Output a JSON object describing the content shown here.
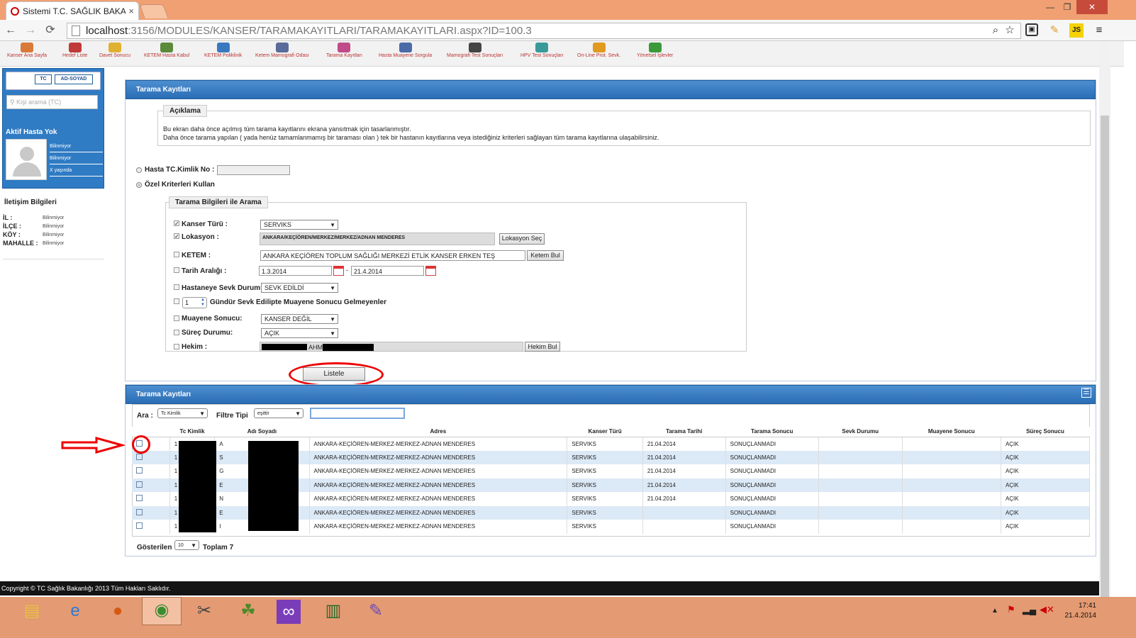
{
  "browser": {
    "tab_title": "Sistemi T.C. SAĞLIK BAKA",
    "tab_close": "×",
    "url_host": "localhost",
    "url_rest": ":3156/MODULES/KANSER/TARAMAKAYITLARI/TARAMAKAYITLARI.aspx?ID=100.3",
    "win_buttons": [
      "—",
      "❐",
      "✕"
    ],
    "nav": [
      "←",
      "→",
      "⟳"
    ]
  },
  "menu": [
    "Kanser Ana Sayfa",
    "Hedef Liste",
    "Davet Sonucu",
    "KETEM Hasta Kabul",
    "KETEM Poliklinik",
    "Ketem Mamografi Odası",
    "Tarama Kayıtları",
    "Hasta Muayene Sorgula",
    "Mamografi Test Sonuçları",
    "HPV Test Sonuçları",
    "On-Line Prot. Sevk.",
    "Yönetsel İşlevler"
  ],
  "sidebar": {
    "tab_tc": "TC",
    "tab_ad": "AD-SOYAD",
    "search_placeholder": "Kişi arama (TC)",
    "aktif": "Aktif Hasta Yok",
    "info": [
      "Bilinmiyor",
      "Bilinmiyor",
      "X yaşında"
    ],
    "iletisim": "İletişim Bilgileri",
    "rows": [
      {
        "k": "İL :",
        "v": "Bilinmiyor"
      },
      {
        "k": "İLÇE :",
        "v": "Bilinmiyor"
      },
      {
        "k": "KÖY :",
        "v": "Bilinmiyor"
      },
      {
        "k": "MAHALLE :",
        "v": "Bilinmiyor"
      }
    ]
  },
  "panel1": {
    "title": "Tarama Kayıtları",
    "aciklama_legend": "Açıklama",
    "desc1": "Bu ekran daha önce açılmış tüm tarama kayıtlarını ekrana yansıtmak için tasarlanmıştır.",
    "desc2": "Daha önce tarama yapılan ( yada henüz tamamlanmamış bir taraması olan ) tek bir hastanın kayıtlarına veya istediğiniz kriterleri sağlayan tüm tarama kayıtlarına ulaşabilirsiniz.",
    "radio_tc": "Hasta TC.Kimlik No :",
    "radio_ozel": "Özel Kriterleri Kullan",
    "search_legend": "Tarama Bilgileri ile Arama",
    "kanser_turu": "Kanser Türü :",
    "kanser_val": "SERVIKS",
    "lokasyon": "Lokasyon :",
    "lokasyon_val": "ANKARA/KEÇİÖREN/MERKEZ/MERKEZ/ADNAN MENDERES",
    "lokasyon_btn": "Lokasyon Seç",
    "ketem": "KETEM :",
    "ketem_val": "ANKARA KEÇİÖREN TOPLUM SAĞLIĞI MERKEZİ ETLİK KANSER ERKEN TEŞ",
    "ketem_btn": "Ketem Bul",
    "tarih": "Tarih Aralığı :",
    "tarih1": "1.3.2014",
    "tarih_sep": "-",
    "tarih2": "21.4.2014",
    "sevk": "Hastaneye Sevk Durum",
    "sevk_val": "SEVK EDİLDİ",
    "gun_val": "1",
    "gun_lbl": "Gündür Sevk Edilipte Muayene Sonucu Gelmeyenler",
    "muayene": "Muayene Sonucu:",
    "muayene_val": "KANSER DEĞİL",
    "surec": "Süreç Durumu:",
    "surec_val": "AÇIK",
    "hekim": "Hekim :",
    "hekim_val": "AHM",
    "hekim_btn": "Hekim Bul",
    "listele": "Listele"
  },
  "panel2": {
    "title": "Tarama Kayıtları",
    "ara": "Ara :",
    "ara_val": "Tc Kimlik",
    "filtre": "Filtre Tipi",
    "filtre_val": "eşittir",
    "columns": [
      "",
      "Tc Kimlik",
      "Adı Soyadı",
      "Adres",
      "Kanser Türü",
      "Tarama Tarihi",
      "Tarama Sonucu",
      "Sevk Durumu",
      "Muayene Sonucu",
      "Süreç Sonucu"
    ],
    "rows": [
      {
        "tc": "1",
        "ad": "A",
        "adres": "ANKARA-KEÇİÖREN-MERKEZ-MERKEZ-ADNAN MENDERES",
        "tur": "SERVIKS",
        "tarih": "21.04.2014",
        "sonuc": "SONUÇLANMADI",
        "sevk": "",
        "muayene": "",
        "surec": "AÇIK"
      },
      {
        "tc": "1",
        "ad": "S",
        "adres": "ANKARA-KEÇİÖREN-MERKEZ-MERKEZ-ADNAN MENDERES",
        "tur": "SERVIKS",
        "tarih": "21.04.2014",
        "sonuc": "SONUÇLANMADI",
        "sevk": "",
        "muayene": "",
        "surec": "AÇIK"
      },
      {
        "tc": "1",
        "ad": "G",
        "adres": "ANKARA-KEÇİÖREN-MERKEZ-MERKEZ-ADNAN MENDERES",
        "tur": "SERVIKS",
        "tarih": "21.04.2014",
        "sonuc": "SONUÇLANMADI",
        "sevk": "",
        "muayene": "",
        "surec": "AÇIK"
      },
      {
        "tc": "1",
        "ad": "E",
        "adres": "ANKARA-KEÇİÖREN-MERKEZ-MERKEZ-ADNAN MENDERES",
        "tur": "SERVIKS",
        "tarih": "21.04.2014",
        "sonuc": "SONUÇLANMADI",
        "sevk": "",
        "muayene": "",
        "surec": "AÇIK"
      },
      {
        "tc": "1",
        "ad": "N",
        "adres": "ANKARA-KEÇİÖREN-MERKEZ-MERKEZ-ADNAN MENDERES",
        "tur": "SERVIKS",
        "tarih": "21.04.2014",
        "sonuc": "SONUÇLANMADI",
        "sevk": "",
        "muayene": "",
        "surec": "AÇIK"
      },
      {
        "tc": "1",
        "ad": "E",
        "adres": "ANKARA-KEÇİÖREN-MERKEZ-MERKEZ-ADNAN MENDERES",
        "tur": "SERVIKS",
        "tarih": "",
        "sonuc": "SONUÇLANMADI",
        "sevk": "",
        "muayene": "",
        "surec": "AÇIK"
      },
      {
        "tc": "1",
        "ad": "I",
        "adres": "ANKARA-KEÇİÖREN-MERKEZ-MERKEZ-ADNAN MENDERES",
        "tur": "SERVIKS",
        "tarih": "",
        "sonuc": "SONUÇLANMADI",
        "sevk": "",
        "muayene": "",
        "surec": "AÇIK"
      }
    ],
    "gosterilen": "Gösterilen",
    "page_size": "10",
    "toplam": "Toplam 7"
  },
  "footer": "Copyright © TC Sağlık Bakanlığı 2013 Tüm Hakları Saklıdır.",
  "clock": {
    "time": "17:41",
    "date": "21.4.2014"
  }
}
